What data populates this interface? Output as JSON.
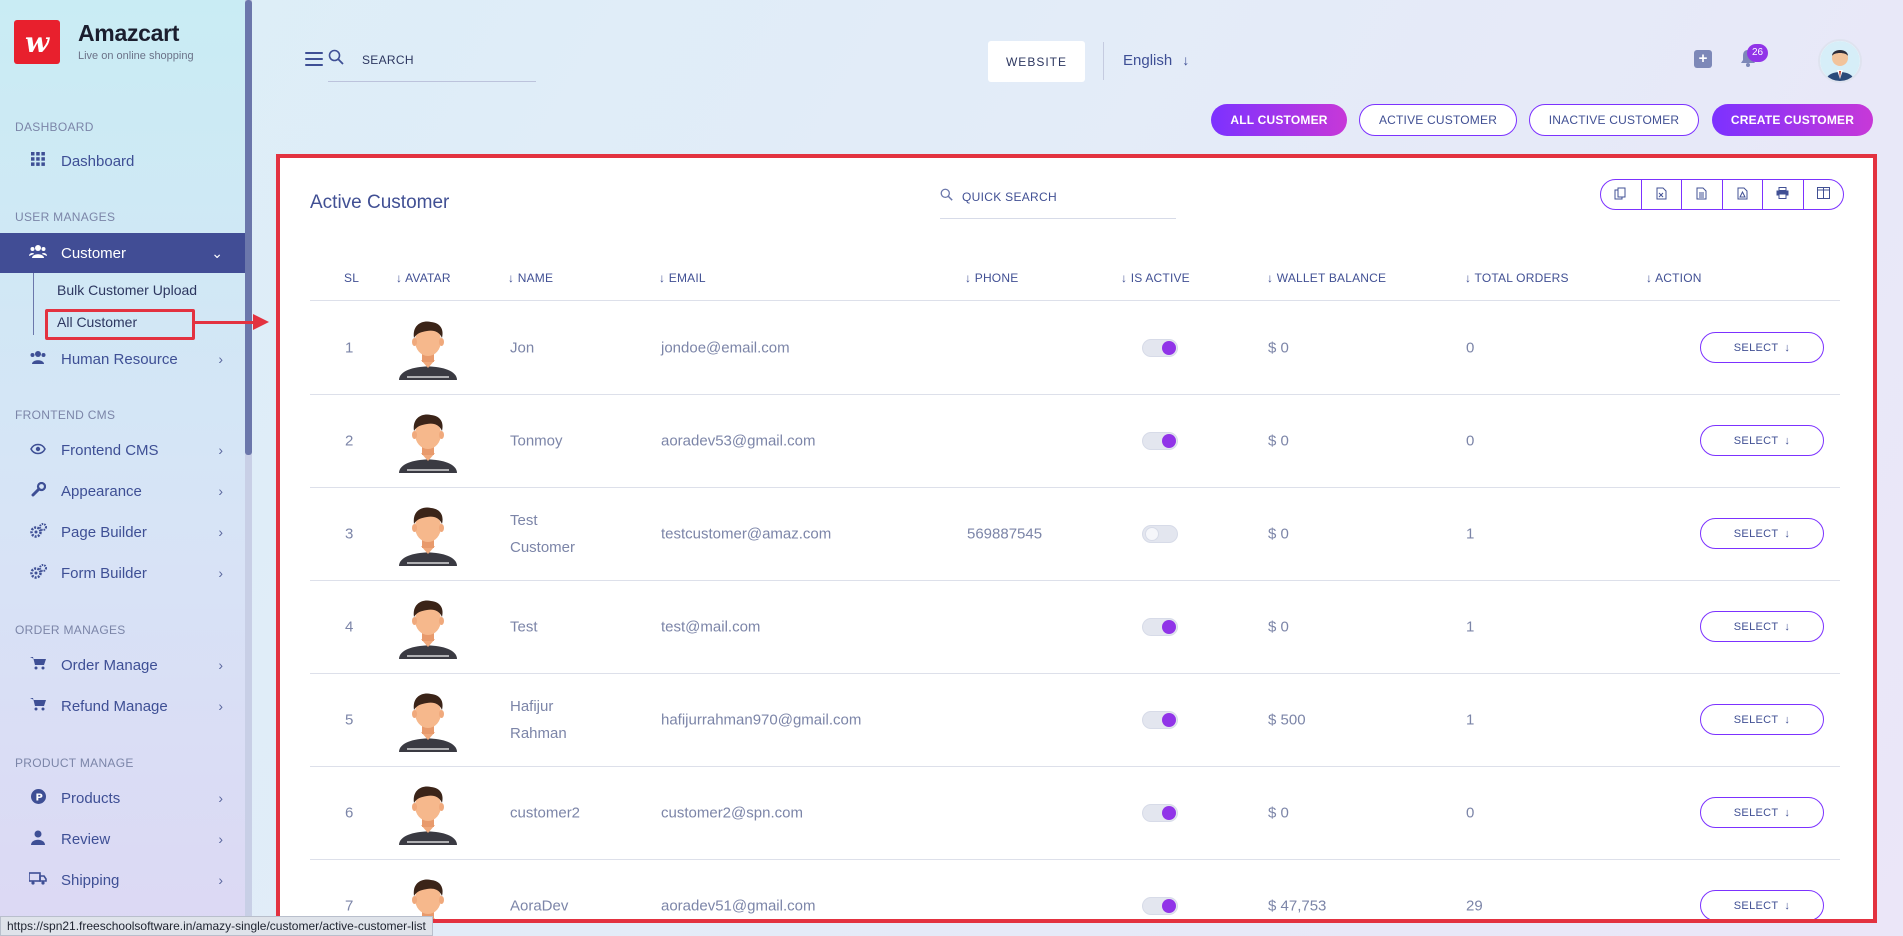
{
  "brand": {
    "name": "Amazcart",
    "tagline": "Live on online shopping",
    "logo_glyph": "w"
  },
  "sidebar": {
    "sections": {
      "dashboard": "DASHBOARD",
      "user_manages": "USER MANAGES",
      "frontend_cms": "FRONTEND CMS",
      "order_manages": "ORDER MANAGES",
      "product_manage": "PRODUCT MANAGE"
    },
    "items": {
      "dashboard": "Dashboard",
      "customer": "Customer",
      "bulk_customer_upload": "Bulk Customer Upload",
      "all_customer": "All Customer",
      "human_resource": "Human Resource",
      "frontend_cms": "Frontend CMS",
      "appearance": "Appearance",
      "page_builder": "Page Builder",
      "form_builder": "Form Builder",
      "order_manage": "Order Manage",
      "refund_manage": "Refund Manage",
      "products": "Products",
      "review": "Review",
      "shipping": "Shipping"
    }
  },
  "header": {
    "search_placeholder": "SEARCH",
    "website_label": "WEBSITE",
    "language": "English",
    "notification_count": "26"
  },
  "tabs": {
    "all_customer": "ALL CUSTOMER",
    "active_customer": "ACTIVE CUSTOMER",
    "inactive_customer": "INACTIVE CUSTOMER",
    "create_customer": "CREATE CUSTOMER"
  },
  "card": {
    "title": "Active Customer",
    "quick_search_placeholder": "QUICK SEARCH",
    "columns": {
      "sl": "SL",
      "avatar": "AVATAR",
      "name": "NAME",
      "email": "EMAIL",
      "phone": "PHONE",
      "is_active": "IS ACTIVE",
      "wallet_balance": "WALLET BALANCE",
      "total_orders": "TOTAL ORDERS",
      "action": "ACTION"
    },
    "select_label": "SELECT",
    "rows": [
      {
        "sl": "1",
        "name": "Jon",
        "email": "jondoe@email.com",
        "phone": "",
        "active": true,
        "wallet": "$ 0",
        "orders": "0"
      },
      {
        "sl": "2",
        "name": "Tonmoy",
        "email": "aoradev53@gmail.com",
        "phone": "",
        "active": true,
        "wallet": "$ 0",
        "orders": "0"
      },
      {
        "sl": "3",
        "name": "Test Customer",
        "email": "testcustomer@amaz.com",
        "phone": "569887545",
        "active": false,
        "wallet": "$ 0",
        "orders": "1"
      },
      {
        "sl": "4",
        "name": "Test",
        "email": "test@mail.com",
        "phone": "",
        "active": true,
        "wallet": "$ 0",
        "orders": "1"
      },
      {
        "sl": "5",
        "name": "Hafijur Rahman",
        "email": "hafijurrahman970@gmail.com",
        "phone": "",
        "active": true,
        "wallet": "$ 500",
        "orders": "1"
      },
      {
        "sl": "6",
        "name": "customer2",
        "email": "customer2@spn.com",
        "phone": "",
        "active": true,
        "wallet": "$ 0",
        "orders": "0"
      },
      {
        "sl": "7",
        "name": "AoraDev",
        "email": "aoradev51@gmail.com",
        "phone": "",
        "active": true,
        "wallet": "$ 47,753",
        "orders": "29"
      }
    ]
  },
  "status_url": "https://spn21.freeschoolsoftware.in/amazy-single/customer/active-customer-list",
  "colors": {
    "accent": "#7c32ff",
    "accent2": "#c738d8",
    "nav_active": "#414d95",
    "highlight": "#e33240"
  }
}
